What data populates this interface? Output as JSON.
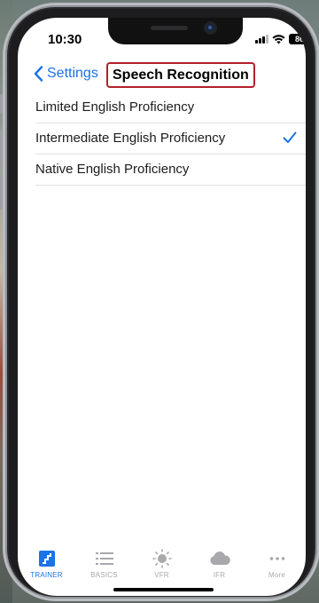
{
  "status_bar": {
    "time": "10:30",
    "battery": "86"
  },
  "navbar": {
    "back_label": "Settings",
    "title": "Speech Recognition"
  },
  "options": [
    {
      "label": "Limited English Proficiency",
      "selected": false
    },
    {
      "label": "Intermediate English Proficiency",
      "selected": true
    },
    {
      "label": "Native English Proficiency",
      "selected": false
    }
  ],
  "tabbar": {
    "tabs": [
      {
        "label": "TRAINER",
        "icon": "trainer-icon",
        "active": true
      },
      {
        "label": "BASICS",
        "icon": "list-icon",
        "active": false
      },
      {
        "label": "VFR",
        "icon": "sun-icon",
        "active": false
      },
      {
        "label": "IFR",
        "icon": "cloud-icon",
        "active": false
      },
      {
        "label": "More",
        "icon": "more-icon",
        "active": false
      }
    ]
  },
  "colors": {
    "accent": "#1a73e8",
    "highlight_border": "#b3202a",
    "inactive_tab": "#a8a8ad"
  }
}
